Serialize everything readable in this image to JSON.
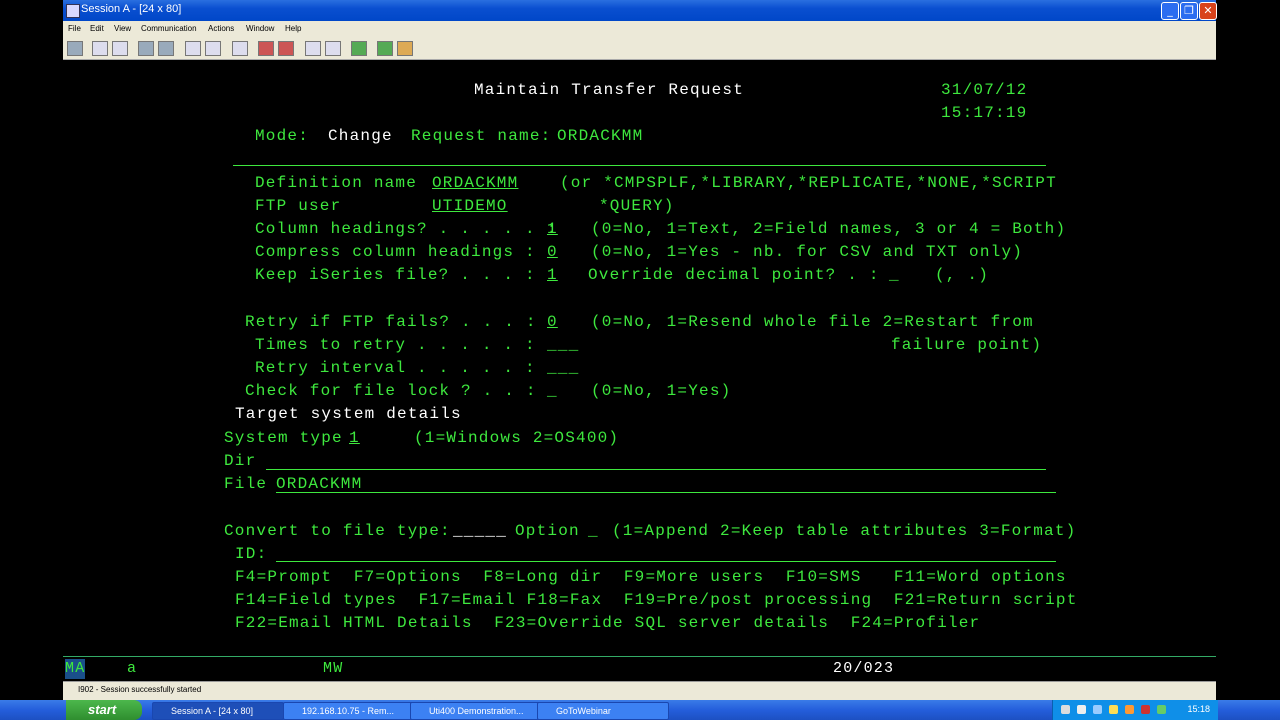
{
  "window": {
    "title": "Session A - [24 x 80]",
    "menu": [
      "File",
      "Edit",
      "View",
      "Communication",
      "Actions",
      "Window",
      "Help"
    ]
  },
  "screen": {
    "title": "Maintain Transfer Request",
    "date": "31/07/12",
    "time": "15:17:19",
    "mode_label": "Mode:",
    "mode_value": "Change",
    "request_label": "Request name:",
    "request_value": "ORDACKMM",
    "definition_label": "Definition name",
    "definition_value": "ORDACKMM",
    "definition_hint1": "(or *CMPSPLF,*LIBRARY,*REPLICATE,*NONE,*SCRIPT",
    "ftp_user_label": "FTP user",
    "ftp_user_value": "UTIDEMO",
    "definition_hint2": "*QUERY)",
    "col_head_label": "Column headings? . . . . . :",
    "col_head_value": "1",
    "col_head_hint": "(0=No, 1=Text, 2=Field names, 3 or 4 = Both)",
    "compress_label": "Compress column headings :",
    "compress_value": "0",
    "compress_hint": "(0=No, 1=Yes - nb. for CSV and TXT only)",
    "keep_label": "Keep iSeries file? . . . :",
    "keep_value": "1",
    "decimal_label": "Override decimal point? . :",
    "decimal_value": "_",
    "decimal_hint": "(, .)",
    "retry_label": "Retry if FTP fails? . . . :",
    "retry_value": "0",
    "retry_hint1": "(0=No, 1=Resend whole file 2=Restart from",
    "times_label": "Times to retry . . . . . :",
    "times_value": "___",
    "retry_hint2": "failure point)",
    "interval_label": "Retry interval . . . . . :",
    "interval_value": "___",
    "lock_label": "Check for file lock ? . . :",
    "lock_value": "_",
    "lock_hint": "(0=No, 1=Yes)",
    "target_heading": "Target system details",
    "sys_type_label": "System type",
    "sys_type_value": "1",
    "sys_type_hint": "(1=Windows 2=OS400)",
    "dir_label": "Dir",
    "dir_value": "",
    "file_label": "File",
    "file_value": "ORDACKMM",
    "convert_label": "Convert to file type:",
    "convert_value": "_____",
    "option_label": "Option",
    "option_value": "_",
    "option_hint": "(1=Append 2=Keep table attributes 3=Format)",
    "id_label": "ID:",
    "id_value": "",
    "fkeys1": "F4=Prompt  F7=Options  F8=Long dir  F9=More users  F10=SMS   F11=Word options",
    "fkeys2": "F14=Field types  F17=Email F18=Fax  F19=Pre/post processing  F21=Return script",
    "fkeys3": "F22=Email HTML Details  F23=Override SQL server details  F24=Profiler"
  },
  "oia": {
    "ma": "MA",
    "a": "a",
    "mw": "MW",
    "cursor": "20/023"
  },
  "status": {
    "message": "I902 - Session successfully started"
  },
  "taskbar": {
    "start": "start",
    "tasks": [
      "Session A - [24 x 80]",
      "192.168.10.75 - Rem...",
      "Uti400 Demonstration...",
      "GoToWebinar"
    ],
    "clock": "15:18"
  }
}
